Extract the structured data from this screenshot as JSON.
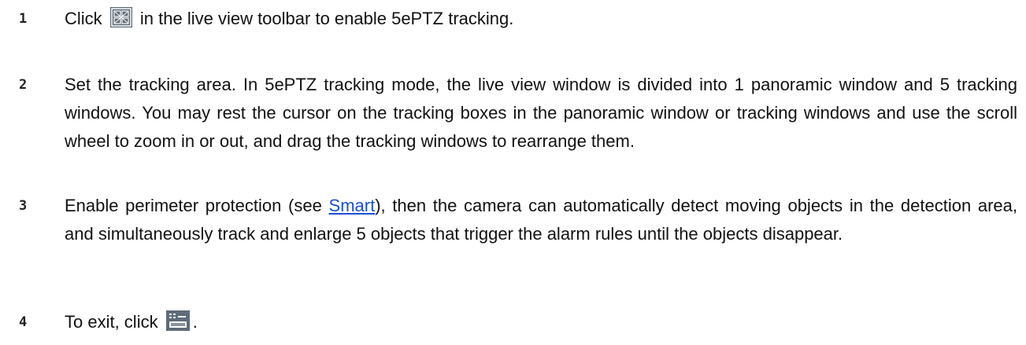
{
  "steps": [
    {
      "number": "1",
      "before_icon": "Click ",
      "icon": "5ePTZ-tracking-icon",
      "after_icon": " in the live view toolbar to enable 5ePTZ tracking."
    },
    {
      "number": "2",
      "text": "Set the tracking area. In 5ePTZ tracking mode, the live view window is divided into 1 panoramic window and 5 tracking windows. You may rest the cursor on the tracking boxes in the panoramic window or tracking windows and use the scroll wheel to zoom in or out, and drag the tracking windows to rearrange them."
    },
    {
      "number": "3",
      "before_link": "Enable perimeter protection (see ",
      "link": "Smart",
      "after_link": "), then the camera can automatically detect moving objects in the detection area, and simultaneously track and enlarge 5 objects that trigger the alarm rules until the objects disappear."
    },
    {
      "number": "4",
      "before_icon": "To exit, click ",
      "icon": "exit-tracking-icon",
      "after_icon": "."
    }
  ],
  "colors": {
    "link": "#1a4fd8",
    "icon_bg": "#5f6b78"
  }
}
